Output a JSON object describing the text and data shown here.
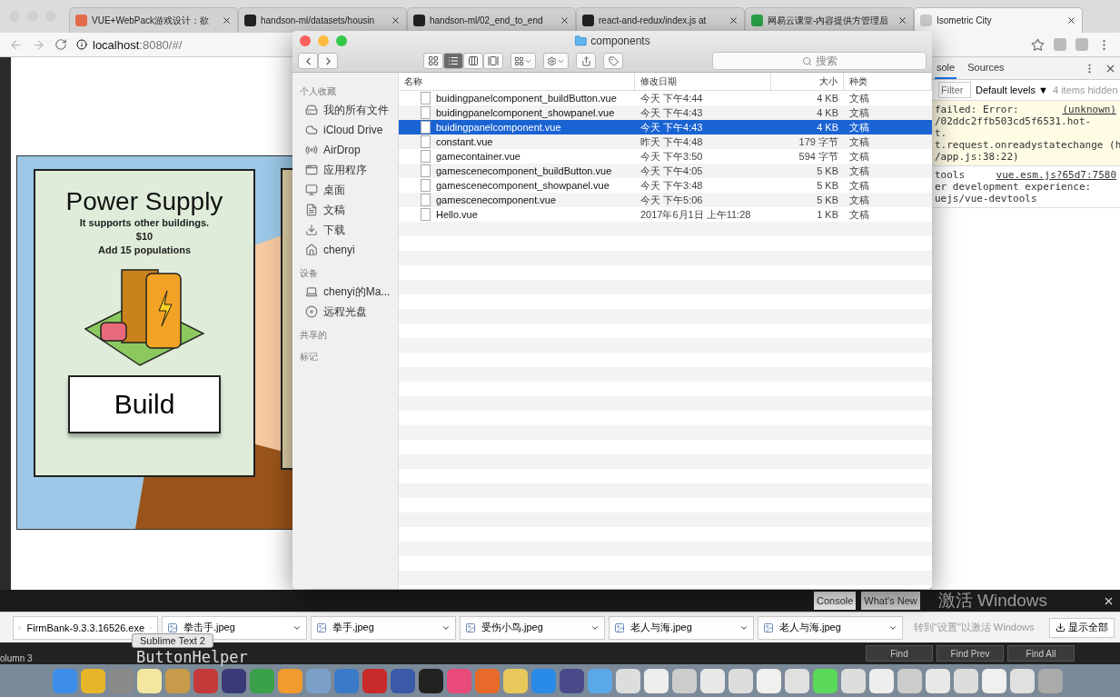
{
  "browser": {
    "tabs": [
      {
        "title": "VUE+WebPack游戏设计：欲",
        "selected": false
      },
      {
        "title": "handson-ml/datasets/housin",
        "selected": false
      },
      {
        "title": "handson-ml/02_end_to_end",
        "selected": false
      },
      {
        "title": "react-and-redux/index.js at",
        "selected": false
      },
      {
        "title": "网易云课堂-内容提供方管理后",
        "selected": false
      },
      {
        "title": "Isometric City",
        "selected": true
      }
    ],
    "url_host": "localhost",
    "url_rest": ":8080/#/"
  },
  "game": {
    "title": "Power Supply",
    "description": "It supports other buildings.",
    "price": "$10",
    "effect": "Add 15 populations",
    "button": "Build"
  },
  "devtools": {
    "tabs": [
      {
        "label": "sole",
        "selected": true
      },
      {
        "label": "Sources",
        "selected": false
      }
    ],
    "filter_placeholder": "Filter",
    "levels": "Default levels ▼",
    "hidden_note": "4 items hidden",
    "messages": [
      {
        "kind": "warning",
        "lines": [
          {
            "text": "failed: Error:",
            "source": "(unknown)"
          },
          {
            "text": "/02ddc2ffb503cd5f6531.hot-"
          },
          {
            "text": "t."
          },
          {
            "text": "t.request.onreadystatechange (h"
          },
          {
            "text": "/app.js:38:22)"
          }
        ]
      },
      {
        "kind": "info",
        "lines": [
          {
            "text": "tools",
            "source": "vue.esm.js?65d7:7580"
          },
          {
            "text": "er development experience:"
          },
          {
            "text": "uejs/vue-devtools"
          }
        ]
      }
    ],
    "drawer_tabs": [
      {
        "label": "Console",
        "selected": true
      },
      {
        "label": "What's New",
        "selected": false
      }
    ]
  },
  "finder": {
    "title": "components",
    "search_placeholder": "搜索",
    "view_modes": [
      {
        "kind": "icons",
        "selected": false
      },
      {
        "kind": "list",
        "selected": true
      },
      {
        "kind": "columns",
        "selected": false
      },
      {
        "kind": "coverflow",
        "selected": false
      }
    ],
    "sidebar": [
      {
        "heading": "个人收藏",
        "items": [
          "我的所有文件",
          "iCloud Drive",
          "AirDrop",
          "应用程序",
          "桌面",
          "文稿",
          "下载",
          "chenyi"
        ]
      },
      {
        "heading": "设备",
        "items": [
          "chenyi的Ma...",
          "远程光盘"
        ]
      },
      {
        "heading": "共享的"
      },
      {
        "heading": "标记"
      }
    ],
    "columns": [
      "名称",
      "修改日期",
      "大小",
      "种类"
    ],
    "rows": [
      {
        "name": "buidingpanelcomponent_buildButton.vue",
        "date": "今天 下午4:44",
        "size": "4 KB",
        "kind": "文稿",
        "selected": false
      },
      {
        "name": "buidingpanelcomponent_showpanel.vue",
        "date": "今天 下午4:43",
        "size": "4 KB",
        "kind": "文稿",
        "selected": false
      },
      {
        "name": "buidingpanelcomponent.vue",
        "date": "今天 下午4:43",
        "size": "4 KB",
        "kind": "文稿",
        "selected": true
      },
      {
        "name": "constant.vue",
        "date": "昨天 下午4:48",
        "size": "179 字节",
        "kind": "文稿",
        "selected": false
      },
      {
        "name": "gamecontainer.vue",
        "date": "今天 下午3:50",
        "size": "594 字节",
        "kind": "文稿",
        "selected": false
      },
      {
        "name": "gamescenecomponent_buildButton.vue",
        "date": "今天 下午4:05",
        "size": "5 KB",
        "kind": "文稿",
        "selected": false
      },
      {
        "name": "gamescenecomponent_showpanel.vue",
        "date": "今天 下午3:48",
        "size": "5 KB",
        "kind": "文稿",
        "selected": false
      },
      {
        "name": "gamescenecomponent.vue",
        "date": "今天 下午5:06",
        "size": "5 KB",
        "kind": "文稿",
        "selected": false
      },
      {
        "name": "Hello.vue",
        "date": "2017年6月1日 上午11:28",
        "size": "1 KB",
        "kind": "文稿",
        "selected": false
      }
    ]
  },
  "downloads": {
    "items": [
      {
        "name": "FirmBank-9.3.3.16526.exe",
        "kind": "file"
      },
      {
        "name": "拳击手.jpeg",
        "kind": "image"
      },
      {
        "name": "拳手.jpeg",
        "kind": "image"
      },
      {
        "name": "受伤小鸟.jpeg",
        "kind": "image"
      },
      {
        "name": "老人与海.jpeg",
        "kind": "image"
      },
      {
        "name": "老人与海.jpeg",
        "kind": "image"
      }
    ],
    "show_all": "显示全部"
  },
  "windows_notice": {
    "title": "激活 Windows",
    "subtitle": "转到\"设置\"以激活 Windows"
  },
  "sublime": {
    "code": "ButtonHelper",
    "status": "olumn 3",
    "buttons": [
      "Find",
      "Find Prev",
      "Find All"
    ],
    "tooltip": "Sublime Text 2"
  }
}
